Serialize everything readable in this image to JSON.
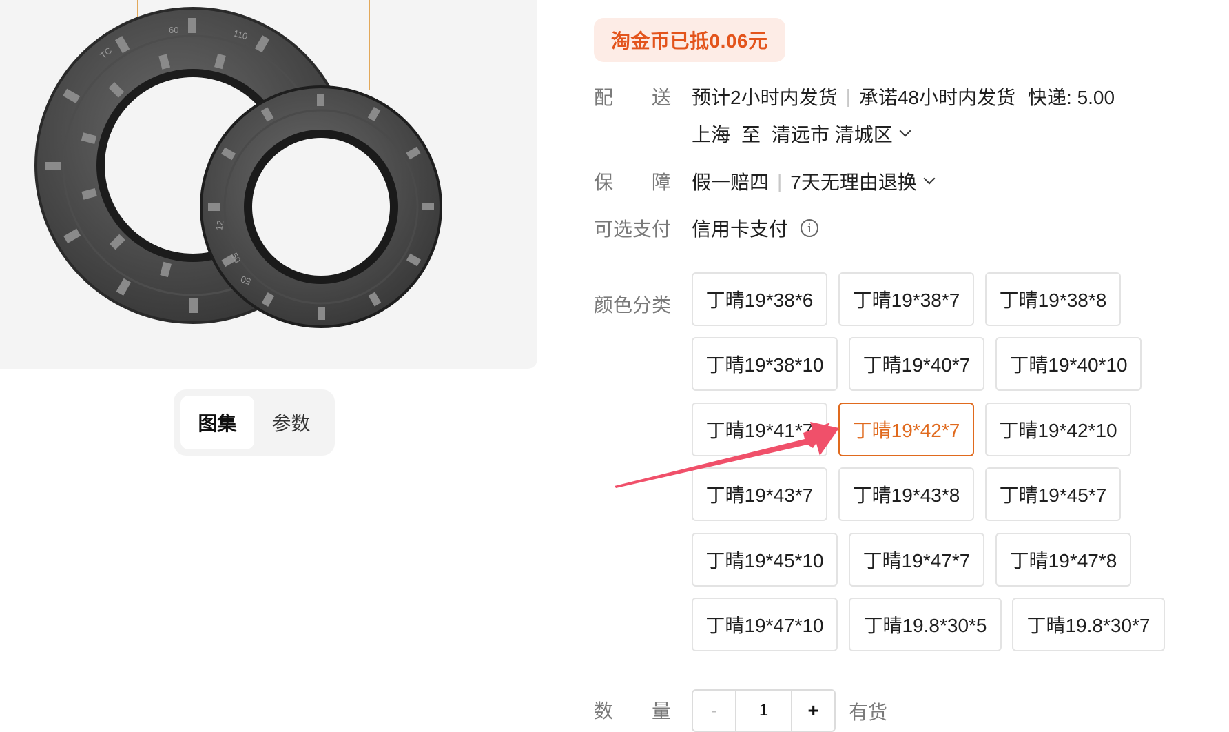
{
  "gallery": {
    "tabs": [
      {
        "label": "图集",
        "active": true
      },
      {
        "label": "参数",
        "active": false
      }
    ],
    "seal_markings": [
      "TC",
      "60",
      "110",
      "12",
      "12",
      "50",
      "50"
    ]
  },
  "coin_badge": "淘金币已抵0.06元",
  "delivery": {
    "label_1": "配",
    "label_2": "送",
    "estimate": "预计2小时内发货",
    "promise": "承诺48小时内发货",
    "shipping": "快递: 5.00",
    "origin": "上海",
    "to": "至",
    "destination": "清远市 清城区"
  },
  "guarantee": {
    "label_1": "保",
    "label_2": "障",
    "item_1": "假一赔四",
    "item_2": "7天无理由退换"
  },
  "payment": {
    "label": "可选支付",
    "method": "信用卡支付",
    "info_icon": "i"
  },
  "sku": {
    "label": "颜色分类",
    "selected": "丁晴19*42*7",
    "options": [
      "丁晴19*38*6",
      "丁晴19*38*7",
      "丁晴19*38*8",
      "丁晴19*38*10",
      "丁晴19*40*7",
      "丁晴19*40*10",
      "丁晴19*41*7",
      "丁晴19*42*7",
      "丁晴19*42*10",
      "丁晴19*43*7",
      "丁晴19*43*8",
      "丁晴19*45*7",
      "丁晴19*45*10",
      "丁晴19*47*7",
      "丁晴19*47*8",
      "丁晴19*47*10",
      "丁晴19.8*30*5",
      "丁晴19.8*30*7"
    ]
  },
  "quantity": {
    "label_1": "数",
    "label_2": "量",
    "minus": "-",
    "value": "1",
    "plus": "+",
    "stock": "有货"
  },
  "colors": {
    "accent": "#e06a1e",
    "badge_bg": "#fdece6",
    "arrow": "#f0506a"
  }
}
